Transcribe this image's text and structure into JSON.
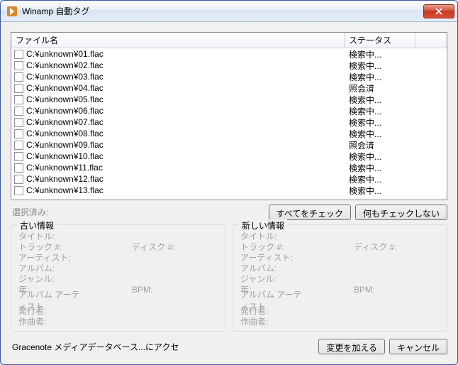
{
  "window": {
    "title": "Winamp 自動タグ"
  },
  "list": {
    "col_file": "ファイル名",
    "col_status": "ステータス",
    "rows": [
      {
        "file": "C:¥unknown¥01.flac",
        "status": "検索中..."
      },
      {
        "file": "C:¥unknown¥02.flac",
        "status": "検索中..."
      },
      {
        "file": "C:¥unknown¥03.flac",
        "status": "検索中..."
      },
      {
        "file": "C:¥unknown¥04.flac",
        "status": "照会済"
      },
      {
        "file": "C:¥unknown¥05.flac",
        "status": "検索中..."
      },
      {
        "file": "C:¥unknown¥06.flac",
        "status": "検索中..."
      },
      {
        "file": "C:¥unknown¥07.flac",
        "status": "検索中..."
      },
      {
        "file": "C:¥unknown¥08.flac",
        "status": "検索中..."
      },
      {
        "file": "C:¥unknown¥09.flac",
        "status": "照会済"
      },
      {
        "file": "C:¥unknown¥10.flac",
        "status": "検索中..."
      },
      {
        "file": "C:¥unknown¥11.flac",
        "status": "検索中..."
      },
      {
        "file": "C:¥unknown¥12.flac",
        "status": "検索中..."
      },
      {
        "file": "C:¥unknown¥13.flac",
        "status": "検索中..."
      }
    ]
  },
  "mid": {
    "selected": "選択済み:",
    "check_all": "すべてをチェック",
    "check_none": "何もチェックしない"
  },
  "panels": {
    "old_title": "古い情報",
    "new_title": "新しい情報",
    "fields": {
      "title": "タイトル:",
      "track": "トラック #:",
      "disc": "ディスク #:",
      "artist": "アーティスト:",
      "album": "アルバム:",
      "genre": "ジャンル:",
      "year": "年:",
      "bpm": "BPM:",
      "album_artist": "アルバム アーティスト",
      "publisher": "発行者:",
      "composer": "作曲者:"
    }
  },
  "footer": {
    "status": "Gracenote メディアデータベース...にアクセ",
    "apply": "変更を加える",
    "cancel": "キャンセル"
  }
}
